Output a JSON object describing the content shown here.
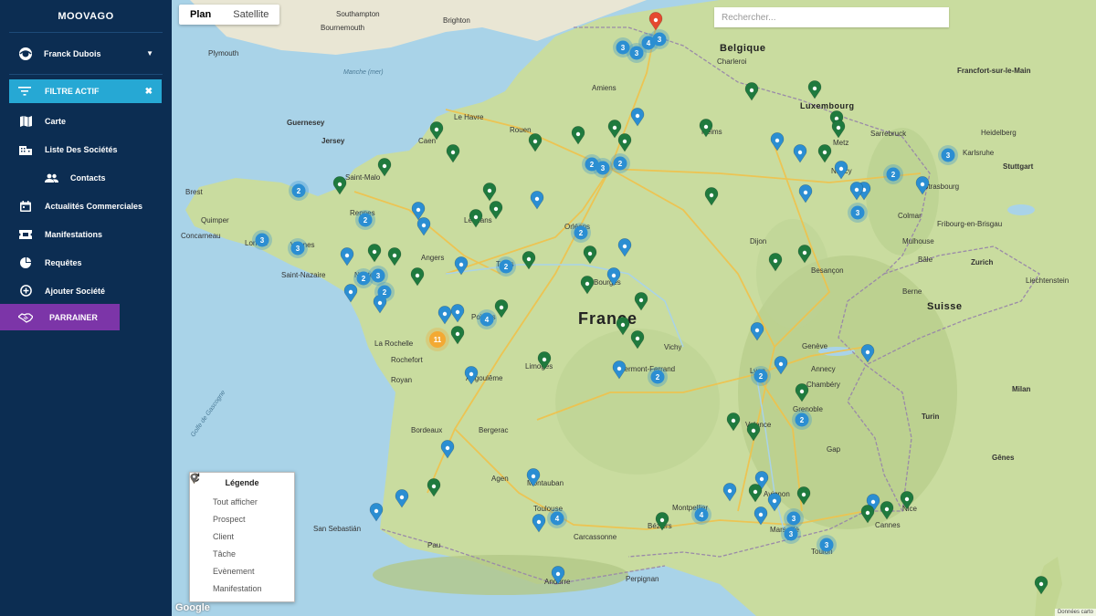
{
  "app": {
    "name": "MOOVAGO"
  },
  "user": {
    "name": "Franck Dubois"
  },
  "filter": {
    "label": "FILTRE ACTIF"
  },
  "nav": {
    "carte": "Carte",
    "societes": "Liste Des Sociétés",
    "contacts": "Contacts",
    "actualites": "Actualités Commerciales",
    "manifestations": "Manifestations",
    "requetes": "Requêtes",
    "ajouter": "Ajouter Société",
    "parrainer": "PARRAINER"
  },
  "map": {
    "type_plan": "Plan",
    "type_satellite": "Satellite",
    "search_placeholder": "Rechercher...",
    "country_label": "France",
    "attribution": "Données carto",
    "google": "Google",
    "places": {
      "belgique": "Belgique",
      "suisse": "Suisse",
      "luxembourg": "Luxembourg",
      "liechtenstein": "Liechtenstein",
      "guernesey": "Guernesey",
      "jersey": "Jersey",
      "southampton": "Southampton",
      "brighton": "Brighton",
      "bournemouth": "Bournemouth",
      "plymouth": "Plymouth",
      "manche": "Manche (mer)",
      "charleroi": "Charleroi",
      "francfort": "Francfort-sur-le-Main",
      "stuttgart": "Stuttgart",
      "zurich": "Zurich",
      "berne": "Berne",
      "turin": "Turin",
      "milan": "Milan",
      "genes": "Gênes",
      "geneve": "Genève",
      "lyon": "Lyon",
      "bordeaux": "Bordeaux",
      "toulouse": "Toulouse",
      "montpellier": "Montpellier",
      "marseille": "Marseille",
      "nantes": "Nantes",
      "rennes": "Rennes",
      "brest": "Brest",
      "quimper": "Quimper",
      "tours": "Tours",
      "orleans": "Orléans",
      "limoges": "Limoges",
      "clermont": "Clermont-Ferrand",
      "dijon": "Dijon",
      "besancon": "Besançon",
      "grenoble": "Grenoble",
      "nice": "Nice",
      "cannes": "Cannes",
      "strasbourg": "Strasbourg",
      "metz": "Metz",
      "nancy": "Nancy",
      "reims": "Reims",
      "amiens": "Amiens",
      "rouen": "Rouen",
      "caen": "Caen",
      "le_havre": "Le Havre",
      "angers": "Angers",
      "le_mans": "Le Mans",
      "la_rochelle": "La Rochelle",
      "poitiers": "Poitiers",
      "perpignan": "Perpignan",
      "andorre": "Andorre",
      "san_sebastian": "San Sebastián",
      "montauban": "Montauban",
      "avignon": "Avignon",
      "valence": "Valence",
      "colmar": "Colmar",
      "bale": "Bâle",
      "mulhouse": "Mulhouse",
      "karlsruhe": "Karlsruhe",
      "heidelberg": "Heidelberg",
      "saint_nazaire": "Saint-Nazaire",
      "vannes": "Vannes",
      "lorient": "Lorient",
      "concarneau": "Concarneau",
      "saint_malo": "Saint-Malo",
      "bourges": "Bourges",
      "vichy": "Vichy",
      "chambery": "Chambéry",
      "annecy": "Annecy",
      "gap": "Gap",
      "carcassonne": "Carcassonne",
      "beziers": "Béziers",
      "toulon": "Toulon",
      "golfe": "Golfe de Gascogne",
      "pau": "Pau",
      "agen": "Agen",
      "bergerac": "Bergerac",
      "angouleme": "Angoulême",
      "rochefort": "Rochefort",
      "royan": "Royan",
      "sarrebruck": "Sarrebruck",
      "fribourg": "Fribourg-en-Brisgau",
      "bale2": "Bâle"
    }
  },
  "legend": {
    "title": "Légende",
    "show_all": "Tout afficher",
    "prospect": "Prospect",
    "client": "Client",
    "tache": "Tâche",
    "evenement": "Evènement",
    "manifestation": "Manifestation"
  },
  "colors": {
    "sidebar": "#0c2d52",
    "filter": "#26a8d4",
    "parrainer": "#7c35a8",
    "prospect": "#2b8ed2",
    "client": "#1f7a3e",
    "tache": "#e5492f",
    "evenement": "#f3a933",
    "manifestation": "#666666"
  },
  "markers": {
    "clusters": [
      {
        "count": "3"
      },
      {
        "count": "4"
      },
      {
        "count": "3"
      },
      {
        "count": "3"
      },
      {
        "count": "2"
      },
      {
        "count": "3"
      },
      {
        "count": "2"
      },
      {
        "count": "2"
      },
      {
        "count": "2"
      },
      {
        "count": "3"
      },
      {
        "count": "3"
      },
      {
        "count": "3"
      },
      {
        "count": "2"
      },
      {
        "count": "2"
      },
      {
        "count": "2"
      },
      {
        "count": "2"
      },
      {
        "count": "2"
      },
      {
        "count": "3"
      },
      {
        "count": "3"
      },
      {
        "count": "4"
      },
      {
        "count": "2"
      },
      {
        "count": "2"
      },
      {
        "count": "2"
      },
      {
        "count": "4"
      },
      {
        "count": "4"
      },
      {
        "count": "3"
      },
      {
        "count": "3"
      },
      {
        "count": "3"
      },
      {
        "count": "11"
      }
    ]
  }
}
